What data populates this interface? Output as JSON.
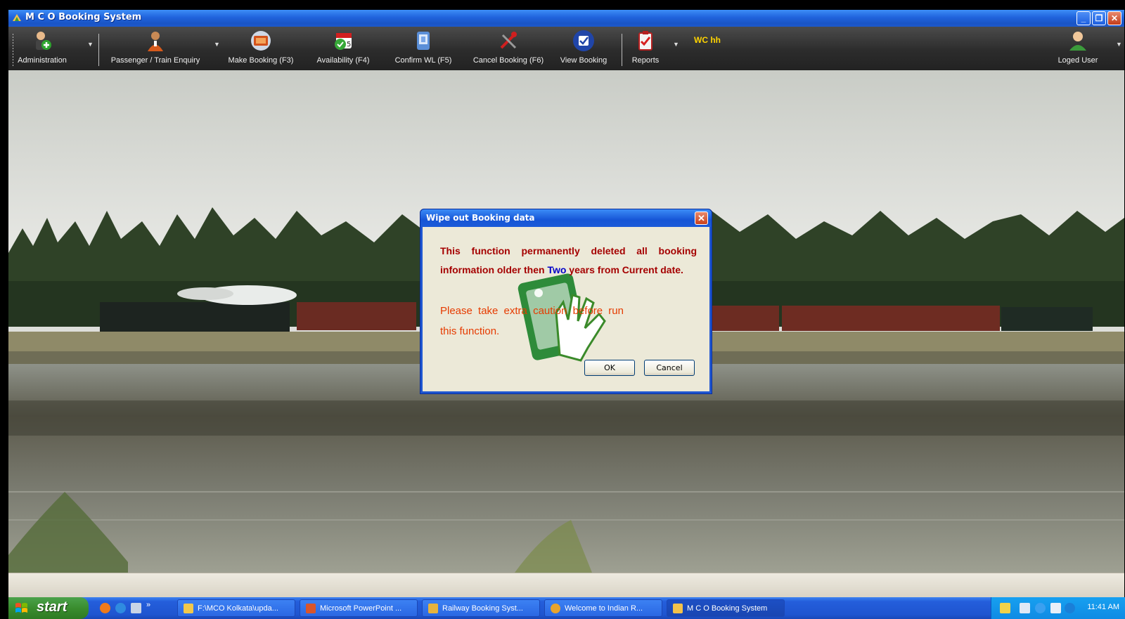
{
  "window": {
    "title": "M C O Booking System",
    "controls": [
      "minimize",
      "restore",
      "close"
    ]
  },
  "toolbar": {
    "items": [
      {
        "label": "Administration",
        "icon": "admin-user-add-icon",
        "dropdown": true
      },
      {
        "label": "Passenger / Train Enquiry",
        "icon": "passenger-icon",
        "dropdown": true
      },
      {
        "label": "Make Booking  (F3)",
        "icon": "book-icon"
      },
      {
        "label": "Availability (F4)",
        "icon": "calendar-icon"
      },
      {
        "label": "Confirm WL (F5)",
        "icon": "confirm-device-icon"
      },
      {
        "label": "Cancel Booking (F6)",
        "icon": "cancel-tools-icon"
      },
      {
        "label": "View Booking",
        "icon": "checkbox-icon"
      },
      {
        "label": "Reports",
        "icon": "clipboard-icon",
        "dropdown": true
      }
    ],
    "user_code": "WC hh",
    "user_label": "Loged User"
  },
  "dialog": {
    "title": "Wipe out Booking data",
    "message_before": "This function permanently deleted all booking information older then ",
    "message_highlight": "Two",
    "message_after": "  years from Current date.",
    "warning_line1": "Please take extra caution before run",
    "warning_line2": "this function.",
    "ok_label": "OK",
    "cancel_label": "Cancel",
    "colors": {
      "message": "#a50000",
      "highlight": "#0000c8",
      "warning": "#e63b00"
    }
  },
  "taskbar": {
    "start_label": "start",
    "tasks": [
      {
        "label": "F:\\MCO Kolkata\\upda...",
        "icon": "folder-icon"
      },
      {
        "label": "Microsoft PowerPoint ...",
        "icon": "powerpoint-icon"
      },
      {
        "label": "Railway Booking Syst...",
        "icon": "railway-app-icon"
      },
      {
        "label": "Welcome to Indian R...",
        "icon": "browser-icon"
      },
      {
        "label": "M C O Booking System",
        "icon": "mco-app-icon",
        "active": true
      }
    ],
    "clock": "11:41 AM"
  }
}
